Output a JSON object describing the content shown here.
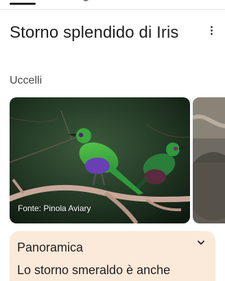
{
  "title": "Storno splendido di Iris",
  "subtitle": "Uccelli",
  "gallery": {
    "credit": "Fonte: Pinola Aviary"
  },
  "overview": {
    "heading": "Panoramica",
    "text": "Lo storno smeraldo è anche"
  },
  "colors": {
    "card_bg": "#fbe9d9",
    "bird_green": "#3fae3a",
    "bird_purple": "#6a3fb5"
  }
}
